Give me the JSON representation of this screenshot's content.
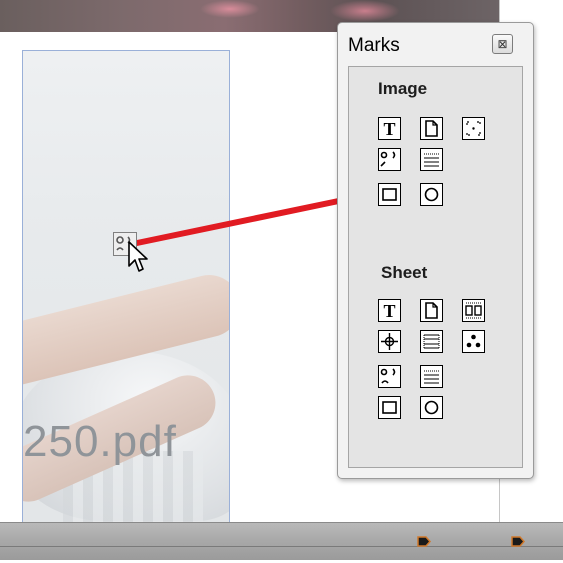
{
  "panel": {
    "title": "Marks",
    "close_glyph": "⊠",
    "sections": [
      {
        "label": "Image",
        "buttons": [
          {
            "name": "text-mark-icon"
          },
          {
            "name": "page-mark-icon"
          },
          {
            "name": "crop-marks-icon"
          },
          {
            "name": "registration-marks-icon"
          },
          {
            "name": "lines-mark-icon"
          },
          {
            "name": "rectangle-mark-icon"
          },
          {
            "name": "circle-mark-icon"
          }
        ]
      },
      {
        "label": "Sheet",
        "buttons": [
          {
            "name": "text-mark-icon"
          },
          {
            "name": "page-mark-icon"
          },
          {
            "name": "duplex-marks-icon"
          },
          {
            "name": "target-mark-icon"
          },
          {
            "name": "fold-marks-icon"
          },
          {
            "name": "dots-mark-icon"
          },
          {
            "name": "registration-marks-icon"
          },
          {
            "name": "lines-mark-icon"
          },
          {
            "name": "rectangle-mark-icon"
          },
          {
            "name": "circle-mark-icon"
          }
        ]
      }
    ]
  },
  "document": {
    "watermark_text": "250.pdf"
  },
  "colors": {
    "drag_line": "#e11b22",
    "keyframe": "#1a1a1a",
    "keyframe_accent": "#d0782a"
  }
}
